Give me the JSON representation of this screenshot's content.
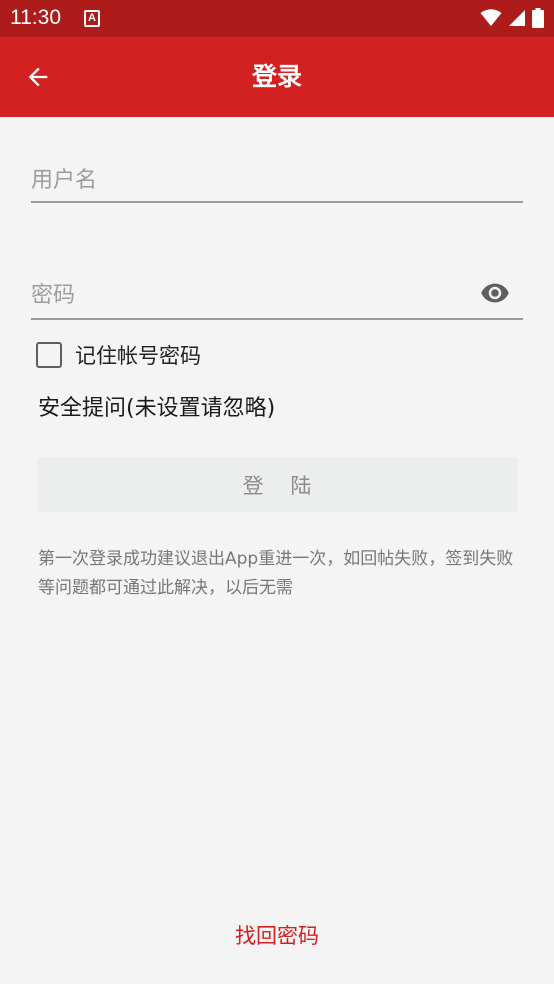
{
  "status_bar": {
    "time": "11:30",
    "notification_glyph": "A",
    "icons": [
      "wifi-icon",
      "signal-icon",
      "battery-icon"
    ],
    "background": "#ad1b1b"
  },
  "app_bar": {
    "title": "登录",
    "back_icon": "arrow-back-icon",
    "background": "#d32020"
  },
  "form": {
    "username_placeholder": "用户名",
    "username_value": "",
    "password_placeholder": "密码",
    "password_value": "",
    "toggle_visibility_icon": "eye-icon",
    "remember_label": "记住帐号密码",
    "remember_checked": false,
    "security_question": "安全提问(未设置请忽略)",
    "login_button": "登 陆"
  },
  "hint": "第一次登录成功建议退出App重进一次，如回帖失败，签到失败等问题都可通过此解决，以后无需",
  "recover_link": "找回密码",
  "colors": {
    "accent": "#d32020",
    "page_background": "#f4f4f4"
  }
}
